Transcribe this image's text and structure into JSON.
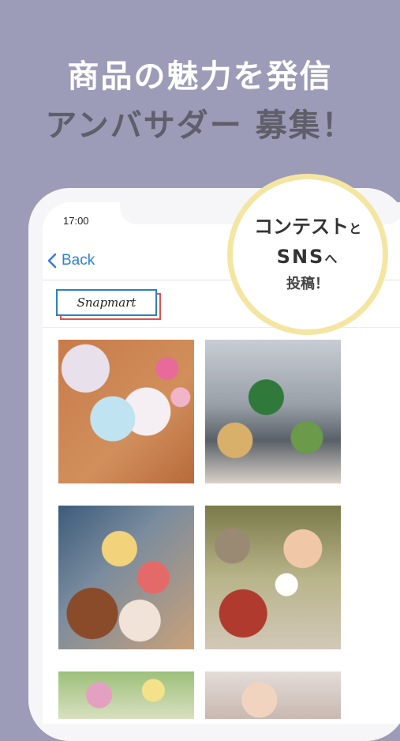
{
  "headline": {
    "line1": "商品の魅力を発信",
    "line2_main": "アンバサダー",
    "line2_accent": "募集！"
  },
  "status_bar": {
    "time": "17:00"
  },
  "nav": {
    "back_label": "Back"
  },
  "logo": {
    "text": "Snapmart"
  },
  "badge": {
    "line1_main": "コンテスト",
    "line1_small": "と",
    "line2_main": "SNS",
    "line2_small": "へ",
    "line3": "投稿！"
  },
  "colors": {
    "background": "#9c9cb8",
    "accent_blue": "#2e7ed8",
    "logo_red": "#d9534f",
    "badge_ring": "#f4e6a2"
  }
}
